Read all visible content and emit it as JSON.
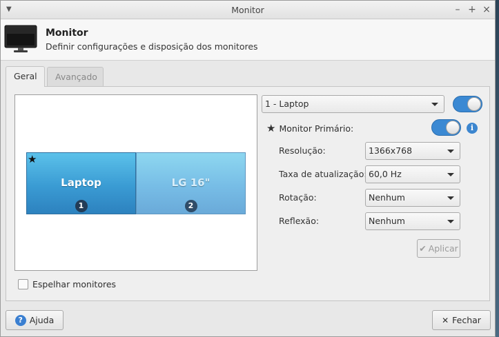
{
  "window": {
    "title": "Monitor"
  },
  "header": {
    "title": "Monitor",
    "subtitle": "Definir configurações e disposição dos monitores",
    "icon": "display-icon"
  },
  "tabs": [
    {
      "label": "Geral",
      "active": true
    },
    {
      "label": "Avançado",
      "active": false
    }
  ],
  "preview": {
    "monitors": [
      {
        "name": "Laptop",
        "number": "1",
        "primary": true
      },
      {
        "name": "LG 16\"",
        "number": "2",
        "primary": false
      }
    ]
  },
  "mirror": {
    "label": "Espelhar monitores",
    "checked": false
  },
  "display_select": {
    "value": "1 - Laptop"
  },
  "display_enabled": true,
  "primary": {
    "label": "Monitor Primário:",
    "enabled": true
  },
  "settings": {
    "resolution": {
      "label": "Resolução:",
      "value": "1366x768"
    },
    "refresh": {
      "label": "Taxa de atualização:",
      "value": "60,0 Hz"
    },
    "rotation": {
      "label": "Rotação:",
      "value": "Nenhum"
    },
    "reflection": {
      "label": "Reflexão:",
      "value": "Nenhum"
    }
  },
  "buttons": {
    "apply": "Aplicar",
    "help": "Ajuda",
    "close": "Fechar"
  },
  "colors": {
    "accent": "#3b89d3",
    "monitor_primary": "#3a9bd3",
    "monitor_secondary": "#77bde6"
  }
}
